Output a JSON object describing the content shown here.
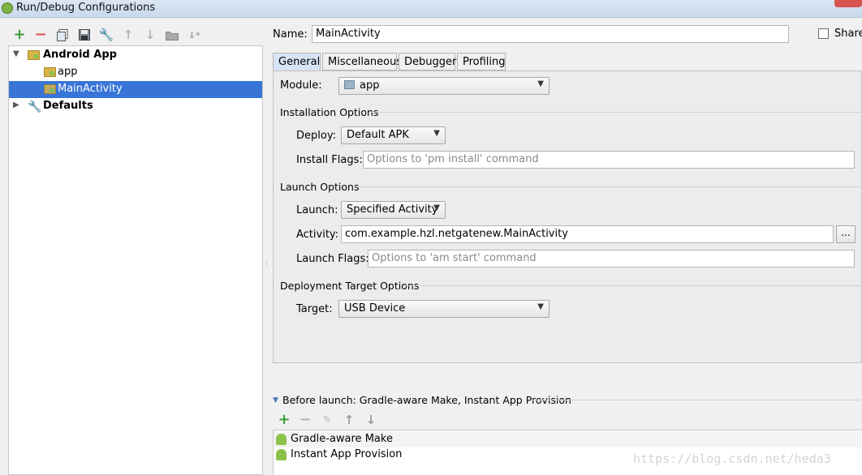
{
  "window": {
    "title": "Run/Debug Configurations"
  },
  "toolbar": {
    "icons": [
      "add-icon",
      "remove-icon",
      "copy-icon",
      "save-icon",
      "edit-defaults-icon",
      "move-up-icon",
      "move-down-icon",
      "folder-icon",
      "sort-icon"
    ]
  },
  "tree": {
    "items": [
      {
        "label": "Android App",
        "bold": true
      },
      {
        "label": "app"
      },
      {
        "label": "MainActivity",
        "selected": true
      },
      {
        "label": "Defaults",
        "bold": true
      }
    ]
  },
  "name": {
    "label": "Name:",
    "value": "MainActivity"
  },
  "share": {
    "label": "Share",
    "checked": false
  },
  "tabs": [
    {
      "label": "General",
      "active": true
    },
    {
      "label": "Miscellaneous"
    },
    {
      "label": "Debugger"
    },
    {
      "label": "Profiling"
    }
  ],
  "general": {
    "module": {
      "label": "Module:",
      "value": "app"
    },
    "installation": {
      "title": "Installation Options",
      "deploy": {
        "label": "Deploy:",
        "value": "Default APK"
      },
      "install_flags": {
        "label": "Install Flags:",
        "placeholder": "Options to 'pm install' command"
      }
    },
    "launch": {
      "title": "Launch Options",
      "launch": {
        "label": "Launch:",
        "value": "Specified Activity"
      },
      "activity": {
        "label": "Activity:",
        "value": "com.example.hzl.netgatenew.MainActivity",
        "browse": "..."
      },
      "launch_flags": {
        "label": "Launch Flags:",
        "placeholder": "Options to 'am start' command"
      }
    },
    "deployment_target": {
      "title": "Deployment Target Options",
      "target": {
        "label": "Target:",
        "value": "USB Device"
      }
    }
  },
  "before_launch": {
    "title": "Before launch: Gradle-aware Make, Instant App Provision",
    "items": [
      {
        "label": "Gradle-aware Make"
      },
      {
        "label": "Instant App Provision"
      }
    ]
  },
  "watermark": "https://blog.csdn.net/heda3",
  "colors": {
    "selection": "#3875d7",
    "add": "#3a9d3a",
    "remove": "#d9534f"
  }
}
